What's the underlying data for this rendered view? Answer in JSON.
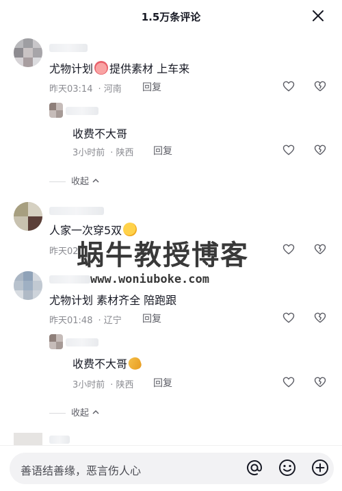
{
  "header": {
    "title": "1.5万条评论"
  },
  "comments": [
    {
      "text_a": "尤物计划",
      "text_b": "提供素材 上车来",
      "time": "昨天03:14",
      "location": "河南",
      "reply_label": "回复",
      "replies": [
        {
          "text": "收费不大哥",
          "time": "3小时前",
          "location": "陕西",
          "reply_label": "回复"
        }
      ],
      "collapse_label": "收起"
    },
    {
      "text_a": "人家一次穿5双",
      "time": "昨天02:",
      "location": "",
      "reply_label": "回复"
    },
    {
      "text_a": "尤物计划 素材齐全 陪跑跟",
      "time": "昨天01:48",
      "location": "辽宁",
      "reply_label": "回复",
      "replies": [
        {
          "text": "收费不大哥",
          "time": "3小时前",
          "location": "陕西",
          "reply_label": "回复"
        }
      ],
      "collapse_label": "收起"
    }
  ],
  "watermark": {
    "main": "蜗牛教授博客",
    "sub": "www.woniuboke.com"
  },
  "input": {
    "placeholder": "善语结善缘，恶言伤人心"
  },
  "icons": {
    "close": "close-icon",
    "like": "heart-icon",
    "dislike": "broken-heart-icon",
    "mention": "at-icon",
    "emoji": "smile-icon",
    "add": "plus-circle-icon"
  },
  "colors": {
    "text": "#161823",
    "meta": "#8a8b91",
    "action": "#5d5e66",
    "input_bg": "#f2f2f4"
  }
}
